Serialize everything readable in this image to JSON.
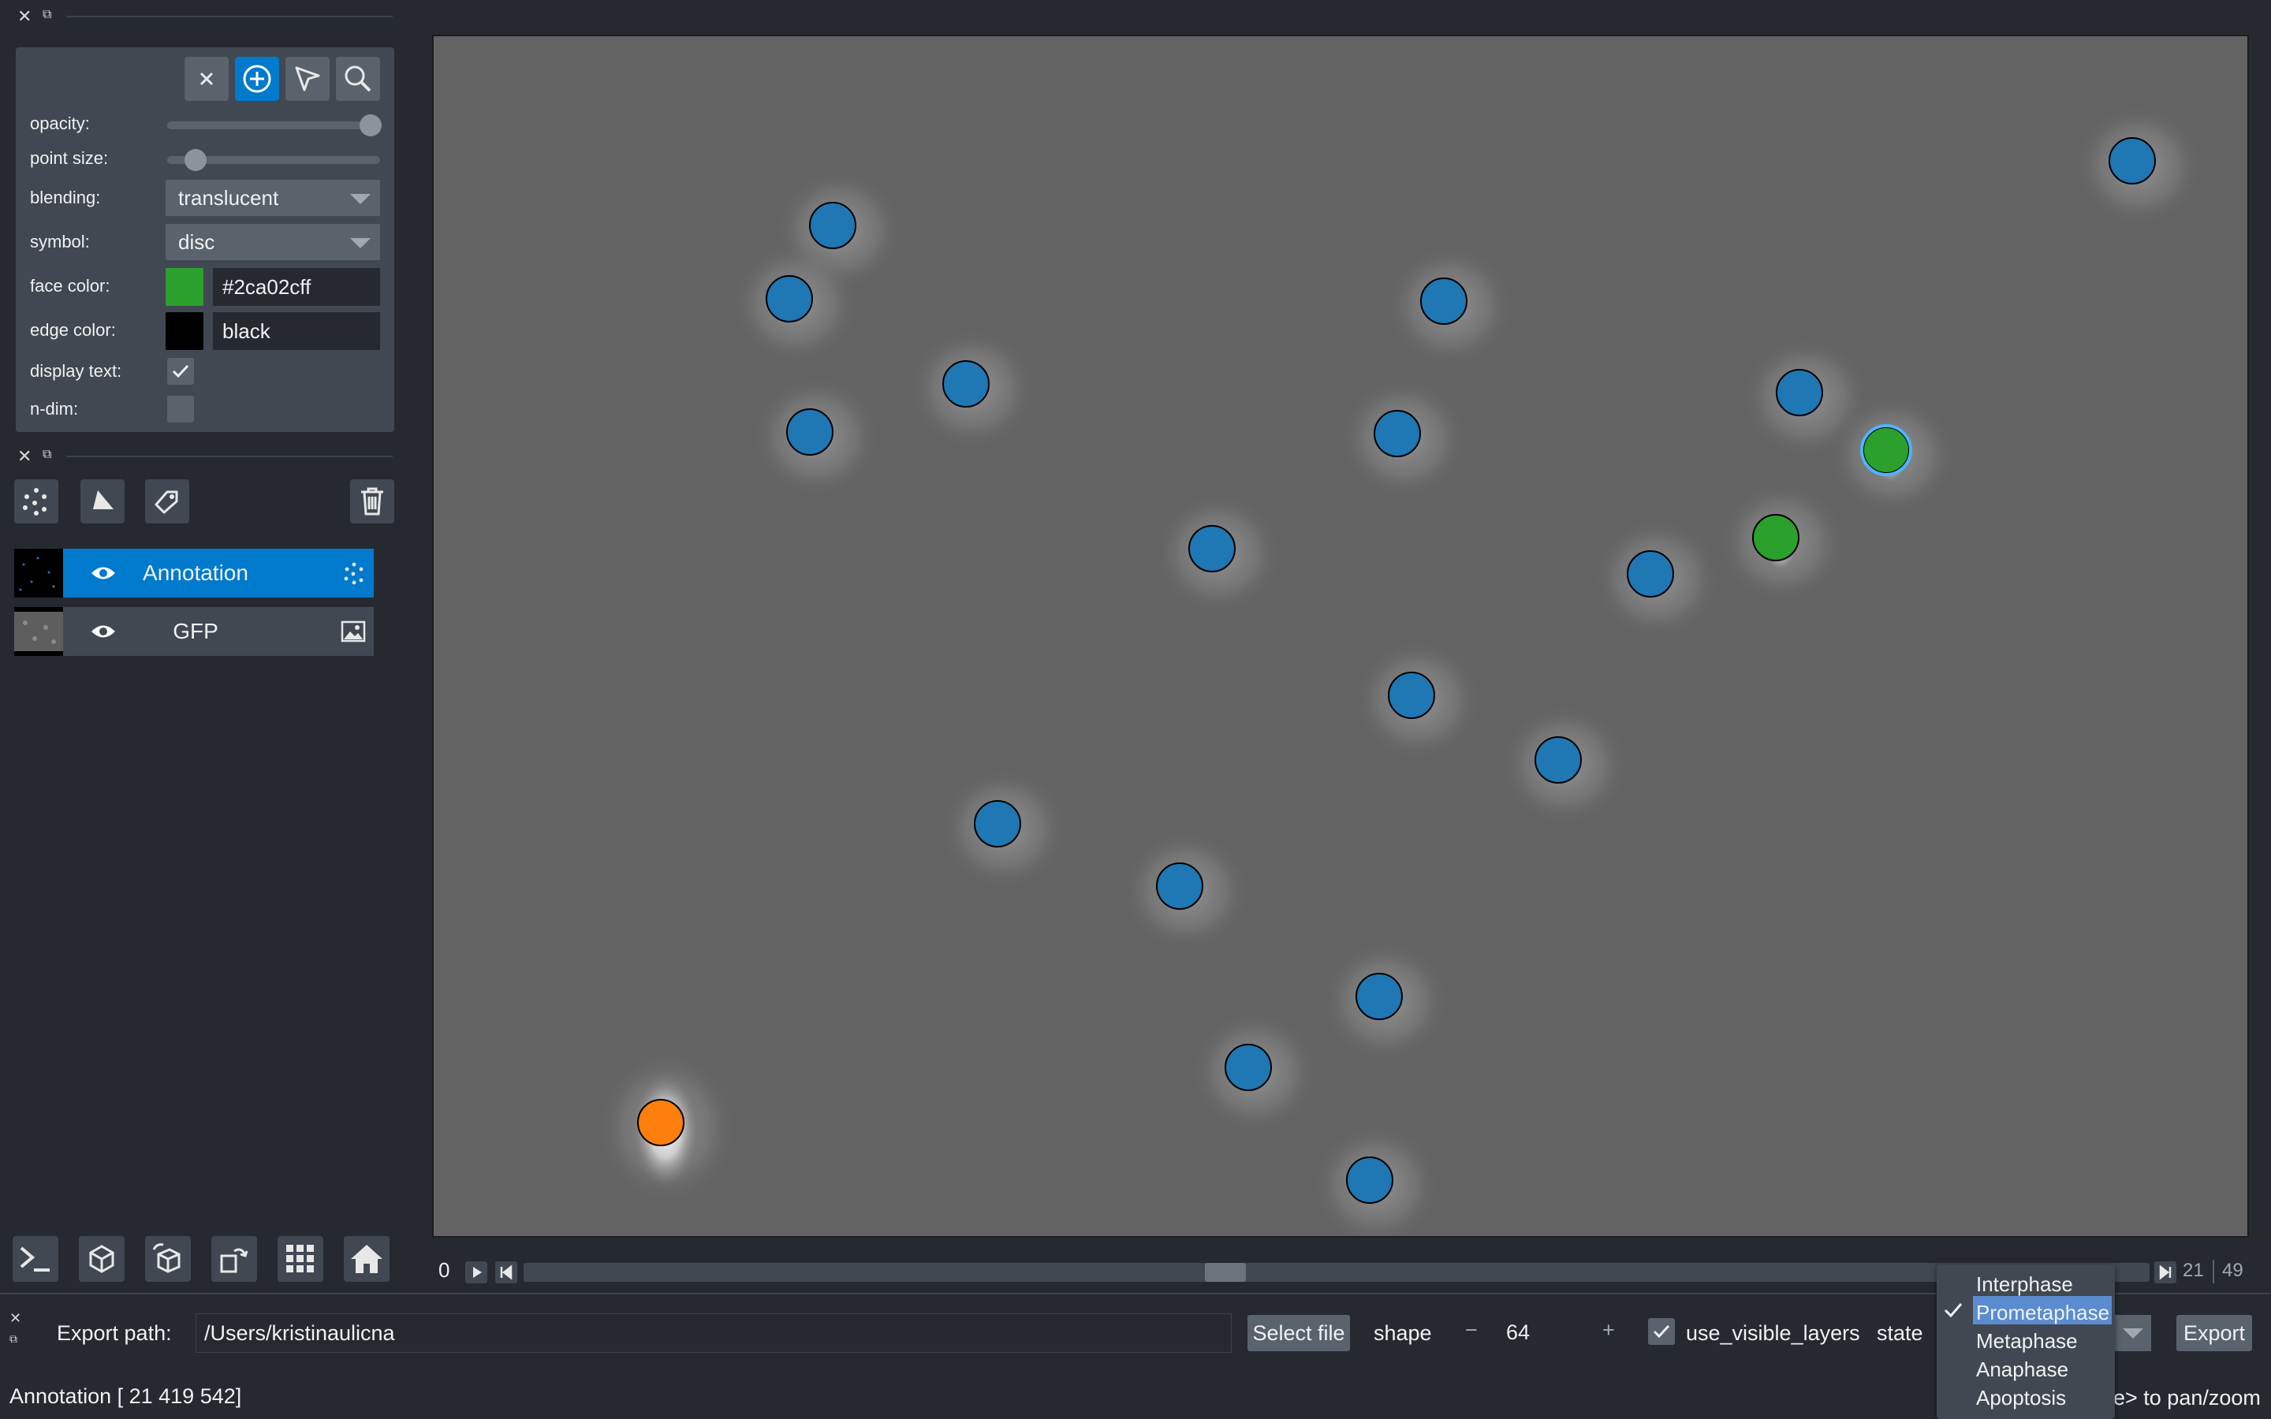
{
  "layer_controls": {
    "mode_buttons": [
      "close-icon",
      "add-points-icon",
      "select-points-icon",
      "pan-zoom-icon"
    ],
    "opacity": {
      "label": "opacity:",
      "value": 1.0
    },
    "point_size": {
      "label": "point size:",
      "value": 0.1
    },
    "blending": {
      "label": "blending:",
      "value": "translucent"
    },
    "symbol": {
      "label": "symbol:",
      "value": "disc"
    },
    "face_color": {
      "label": "face color:",
      "value": "#2ca02cff",
      "swatch": "#2ca02c"
    },
    "edge_color": {
      "label": "edge color:",
      "value": "black",
      "swatch": "#000000"
    },
    "display_text": {
      "label": "display text:",
      "checked": true
    },
    "n_dim": {
      "label": "n-dim:",
      "checked": false
    }
  },
  "layer_list": {
    "tools": [
      "new-points-icon",
      "new-shapes-icon",
      "new-labels-icon",
      "delete-layer-icon"
    ],
    "layers": [
      {
        "name": "Annotation",
        "type": "points",
        "selected": true,
        "visible": true
      },
      {
        "name": "GFP",
        "type": "image",
        "selected": false,
        "visible": true
      }
    ]
  },
  "viewer_buttons": [
    "console-icon",
    "ndisplay-icon",
    "roll-icon",
    "transpose-icon",
    "grid-icon",
    "home-icon"
  ],
  "dims": {
    "left_value": "0",
    "frame": "21",
    "total": "49",
    "position": 0.43
  },
  "export_widget": {
    "path_label": "Export path:",
    "path_value": "/Users/kristinaulicna",
    "select_file": "Select file",
    "shape_label": "shape",
    "shape_value": "64",
    "use_visible_layers_label": "use_visible_layers",
    "use_visible_layers_checked": true,
    "state_label": "state",
    "export_button": "Export",
    "state_options": [
      "Interphase",
      "Prometaphase",
      "Metaphase",
      "Anaphase",
      "Apoptosis"
    ],
    "state_selected": "Prometaphase"
  },
  "status_bar": {
    "left": "Annotation [ 21 419 542]",
    "right": "e> to pan/zoom"
  },
  "colors": {
    "blue_point": "#1f77b4",
    "green_point": "#2ca02c",
    "orange_point": "#ff7f0e",
    "accent": "#007acc"
  }
}
